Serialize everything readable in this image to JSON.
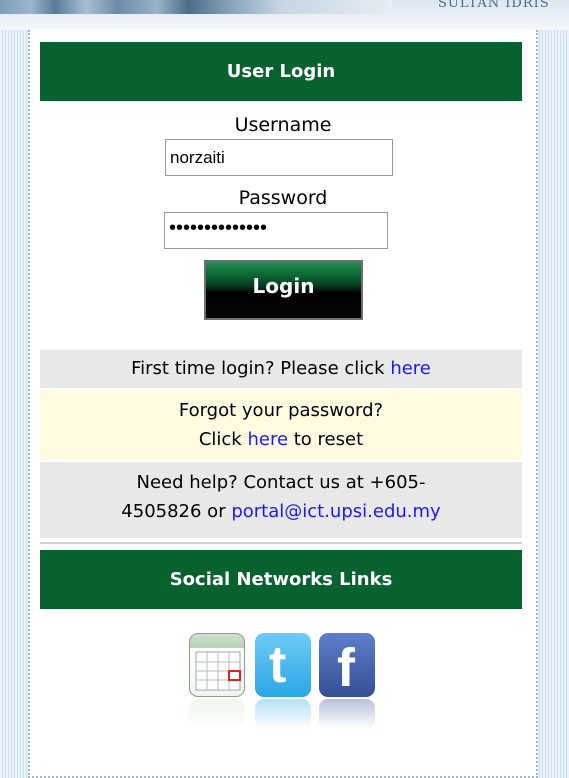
{
  "banner": {
    "text": "SULTAN IDRIS"
  },
  "login": {
    "header": "User Login",
    "username_label": "Username",
    "username_value": "norzaiti",
    "password_label": "Password",
    "password_masked": "••••••••••••••",
    "login_button": "Login"
  },
  "help": {
    "first_time_text": "First time login? Please click ",
    "first_time_link": "here",
    "forgot_line1": "Forgot your password?",
    "forgot_click": "Click ",
    "forgot_link": "here",
    "forgot_suffix": " to reset",
    "contact_line1": "Need help? Contact us at +605-",
    "contact_line2_prefix": "4505826 or ",
    "contact_email": "portal@ict.upsi.edu.my"
  },
  "social": {
    "header": "Social Networks Links",
    "icons": [
      "calendar-icon",
      "twitter-icon",
      "facebook-icon"
    ]
  },
  "colors": {
    "header_green": "#07622f",
    "link_blue": "#1a1aff",
    "cream": "#fffbe0",
    "gray": "#e8e8e8"
  }
}
